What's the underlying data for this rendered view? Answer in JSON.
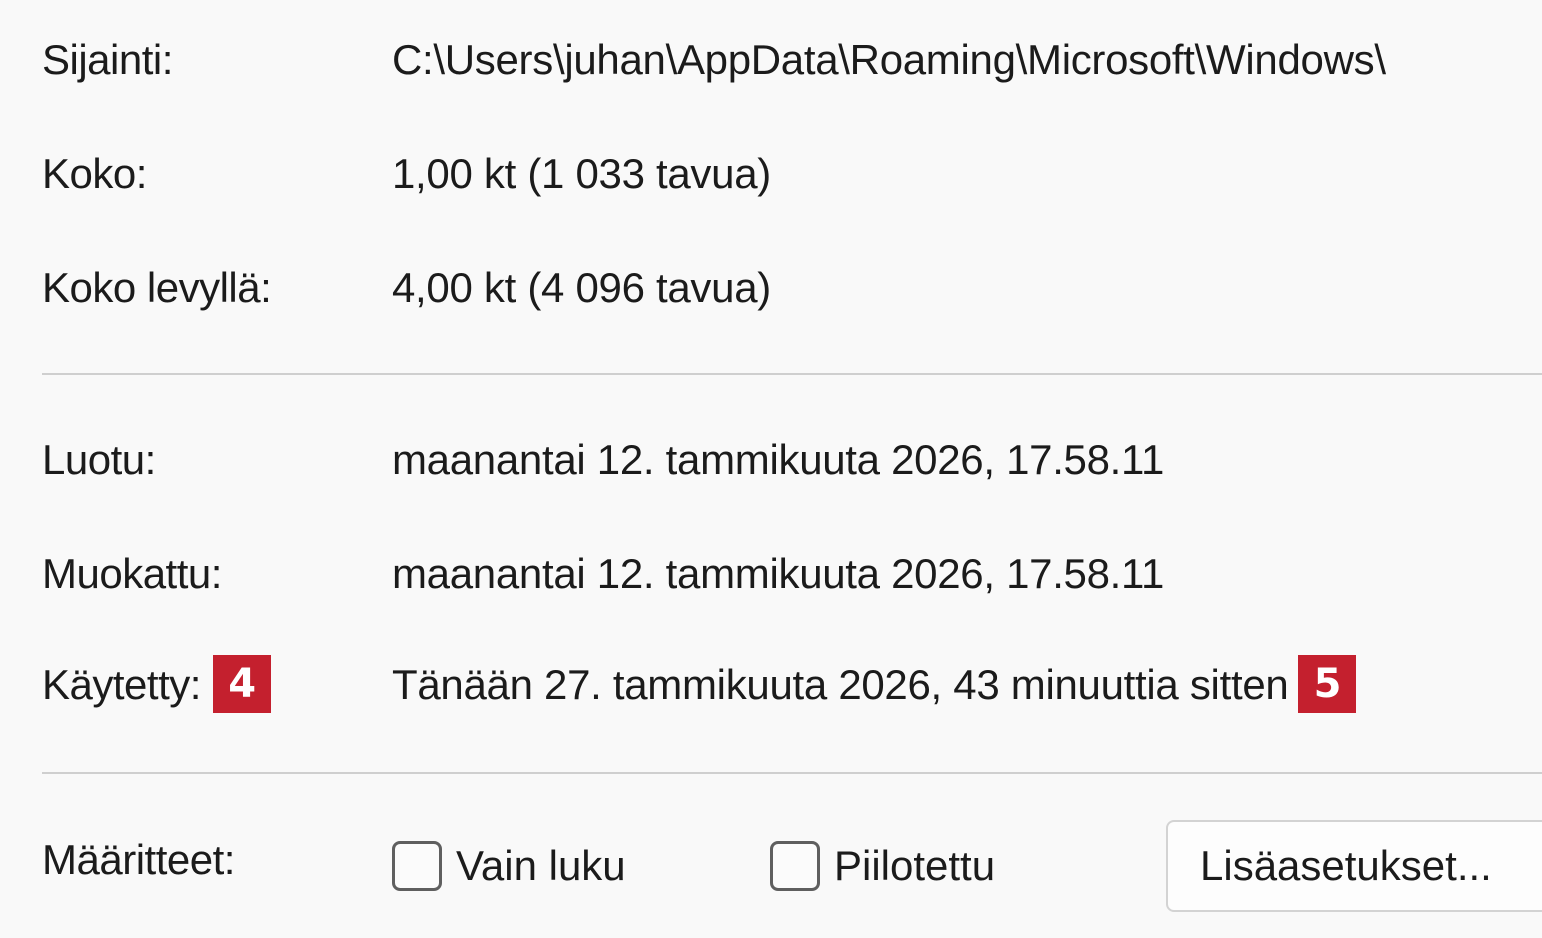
{
  "properties": {
    "location_label": "Sijainti:",
    "location_value": "C:\\Users\\juhan\\AppData\\Roaming\\Microsoft\\Windows\\",
    "size_label": "Koko:",
    "size_value": "1,00 kt (1 033 tavua)",
    "size_on_disk_label": "Koko levyllä:",
    "size_on_disk_value": "4,00 kt (4 096 tavua)",
    "created_label": "Luotu:",
    "created_value": "maanantai 12. tammikuuta 2026, 17.58.11",
    "modified_label": "Muokattu:",
    "modified_value": "maanantai 12. tammikuuta 2026, 17.58.11",
    "accessed_label": "Käytetty:",
    "accessed_value": "Tänään 27. tammikuuta 2026, 43 minuuttia sitten"
  },
  "annotations": {
    "badge_accessed_label": "4",
    "badge_accessed_value": "5",
    "badge_color": "#c4202e"
  },
  "attributes": {
    "label": "Määritteet:",
    "readonly_label": "Vain luku",
    "readonly_checked": false,
    "hidden_label": "Piilotettu",
    "hidden_checked": false,
    "advanced_button": "Lisäasetukset..."
  }
}
